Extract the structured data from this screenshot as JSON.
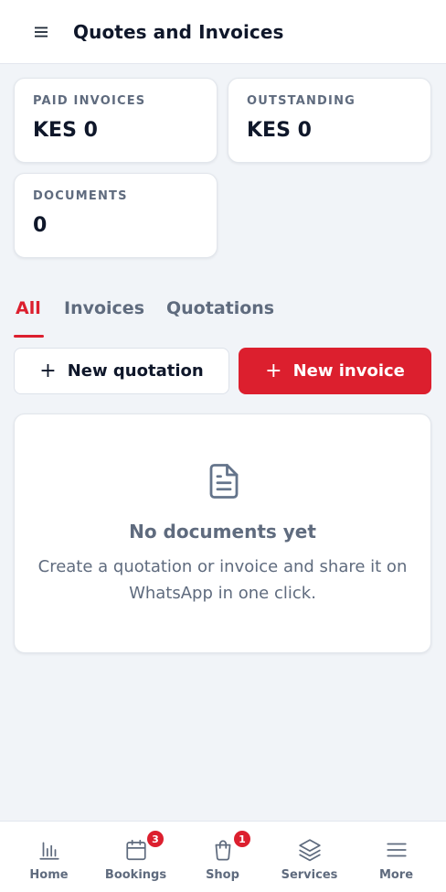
{
  "header": {
    "title": "Quotes and Invoices",
    "menu_icon": "hamburger-menu-icon"
  },
  "stats": [
    {
      "label": "PAID INVOICES",
      "value": "KES 0"
    },
    {
      "label": "OUTSTANDING",
      "value": "KES 0"
    },
    {
      "label": "DOCUMENTS",
      "value": "0"
    }
  ],
  "tabs": [
    {
      "label": "All",
      "active": true
    },
    {
      "label": "Invoices",
      "active": false
    },
    {
      "label": "Quotations",
      "active": false
    }
  ],
  "actions": {
    "new_quotation": {
      "icon": "+",
      "label": "New quotation"
    },
    "new_invoice": {
      "icon": "+",
      "label": "New invoice"
    }
  },
  "empty_state": {
    "icon": "document-icon",
    "title": "No documents yet",
    "description": "Create a quotation or invoice and share it on WhatsApp in one click."
  },
  "bottom_nav": [
    {
      "label": "Home",
      "icon": "bar-chart-icon",
      "badge": null
    },
    {
      "label": "Bookings",
      "icon": "calendar-icon",
      "badge": "3"
    },
    {
      "label": "Shop",
      "icon": "shopping-bag-icon",
      "badge": "1"
    },
    {
      "label": "Services",
      "icon": "layers-icon",
      "badge": null
    },
    {
      "label": "More",
      "icon": "menu-icon",
      "badge": null
    }
  ],
  "colors": {
    "accent": "#dc1f2e",
    "background": "#f1f4f8",
    "muted_text": "#5f6b7e",
    "heading_text": "#0f172a"
  }
}
